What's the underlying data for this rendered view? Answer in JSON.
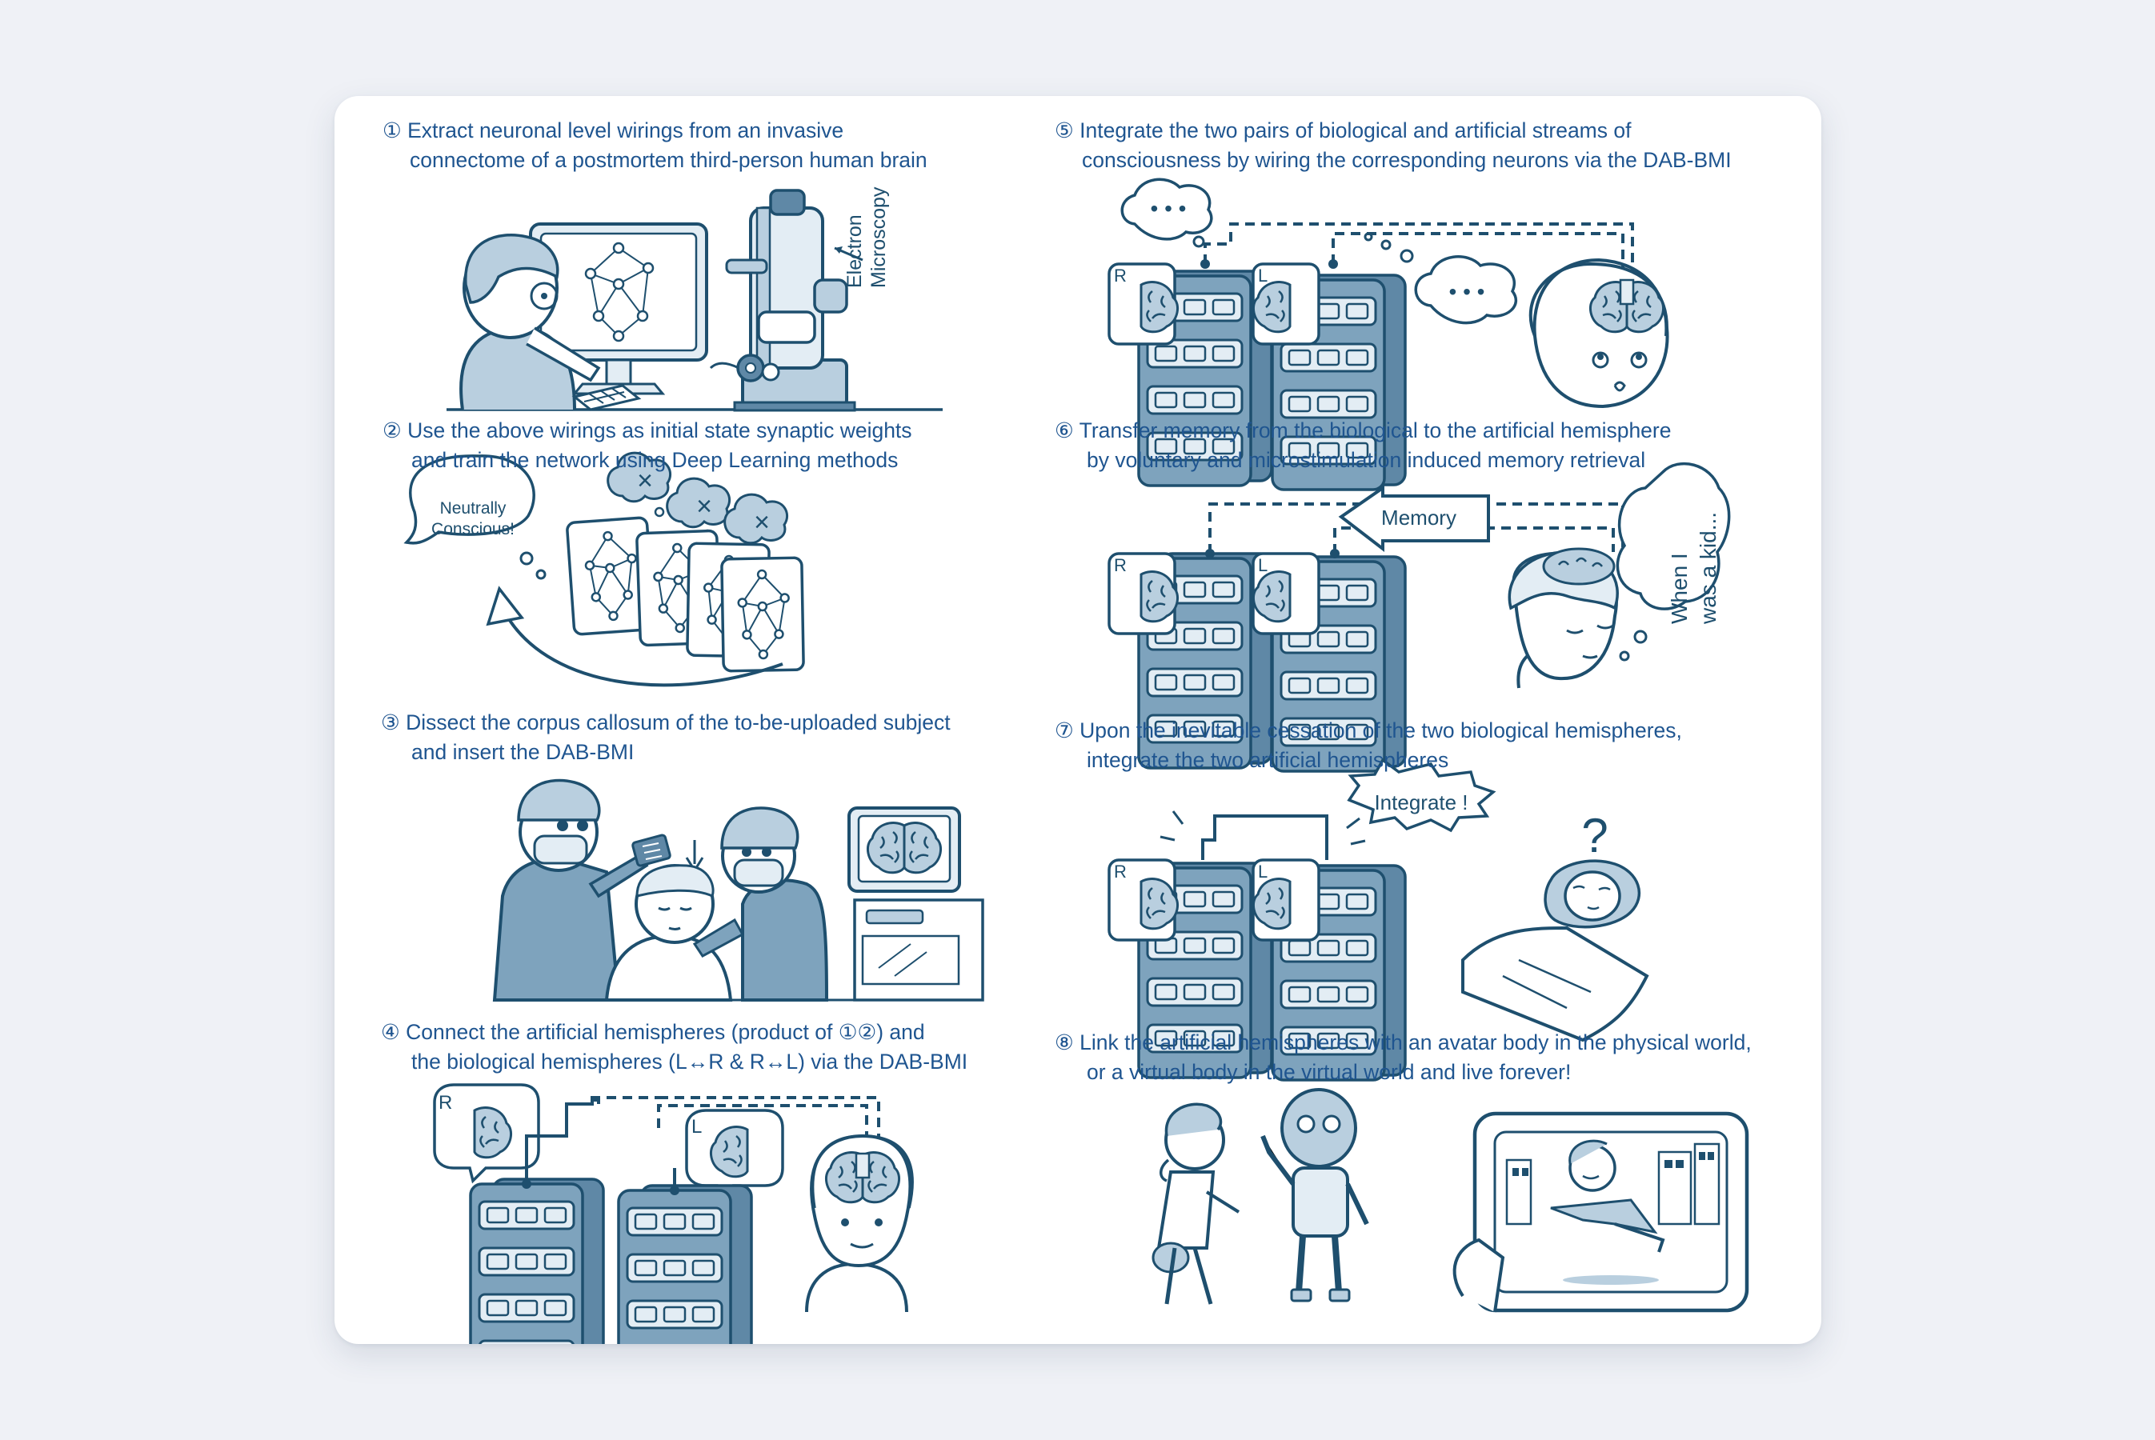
{
  "steps": [
    {
      "line1": "① Extract neuronal level wirings from an invasive",
      "line2": "connectome of a postmortem third-person human brain"
    },
    {
      "line1": "② Use the above wirings as initial state synaptic weights",
      "line2": "and train the network using Deep Learning methods"
    },
    {
      "line1": "③ Dissect the corpus callosum of the to-be-uploaded subject",
      "line2": "and insert the DAB-BMI"
    },
    {
      "line1": "④ Connect the artificial hemispheres (product of ①②) and",
      "line2": "the biological hemispheres (L↔R & R↔L)  via the DAB-BMI"
    },
    {
      "line1": "⑤ Integrate the two pairs of biological and artificial streams of",
      "line2": "consciousness by wiring the corresponding neurons via the DAB-BMI"
    },
    {
      "line1": "⑥ Transfer memory from the biological to the artificial hemisphere",
      "line2": "by voluntary and microstimulation induced memory retrieval"
    },
    {
      "line1": "⑦ Upon the inevitable cessation of the two biological hemispheres,",
      "line2": "integrate the two artificial hemispheres"
    },
    {
      "line1": "⑧ Link the artificial hemispheres with an avatar body in the physical world,",
      "line2": "or a virtual body in the virtual world and live forever!"
    }
  ],
  "labels": {
    "microscope_line1": "Electron",
    "microscope_line2": "Microscopy",
    "conscious_line1": "Neutrally",
    "conscious_line2": "Conscious!",
    "reject_mark": "×",
    "thought_dots": "• • •",
    "memory": "Memory",
    "thought_line1": "When I",
    "thought_line2": "was a kid...",
    "integrate": "Integrate !",
    "rack_left": "L",
    "rack_right": "R",
    "question": "?"
  },
  "colors": {
    "background": "#eff1f6",
    "card": "#ffffff",
    "ink": "#1e4f6e",
    "text": "#1f5590",
    "fill": "#5f88a6",
    "fill_light": "#b9cfdf",
    "fill_pale": "#e3edf4"
  }
}
